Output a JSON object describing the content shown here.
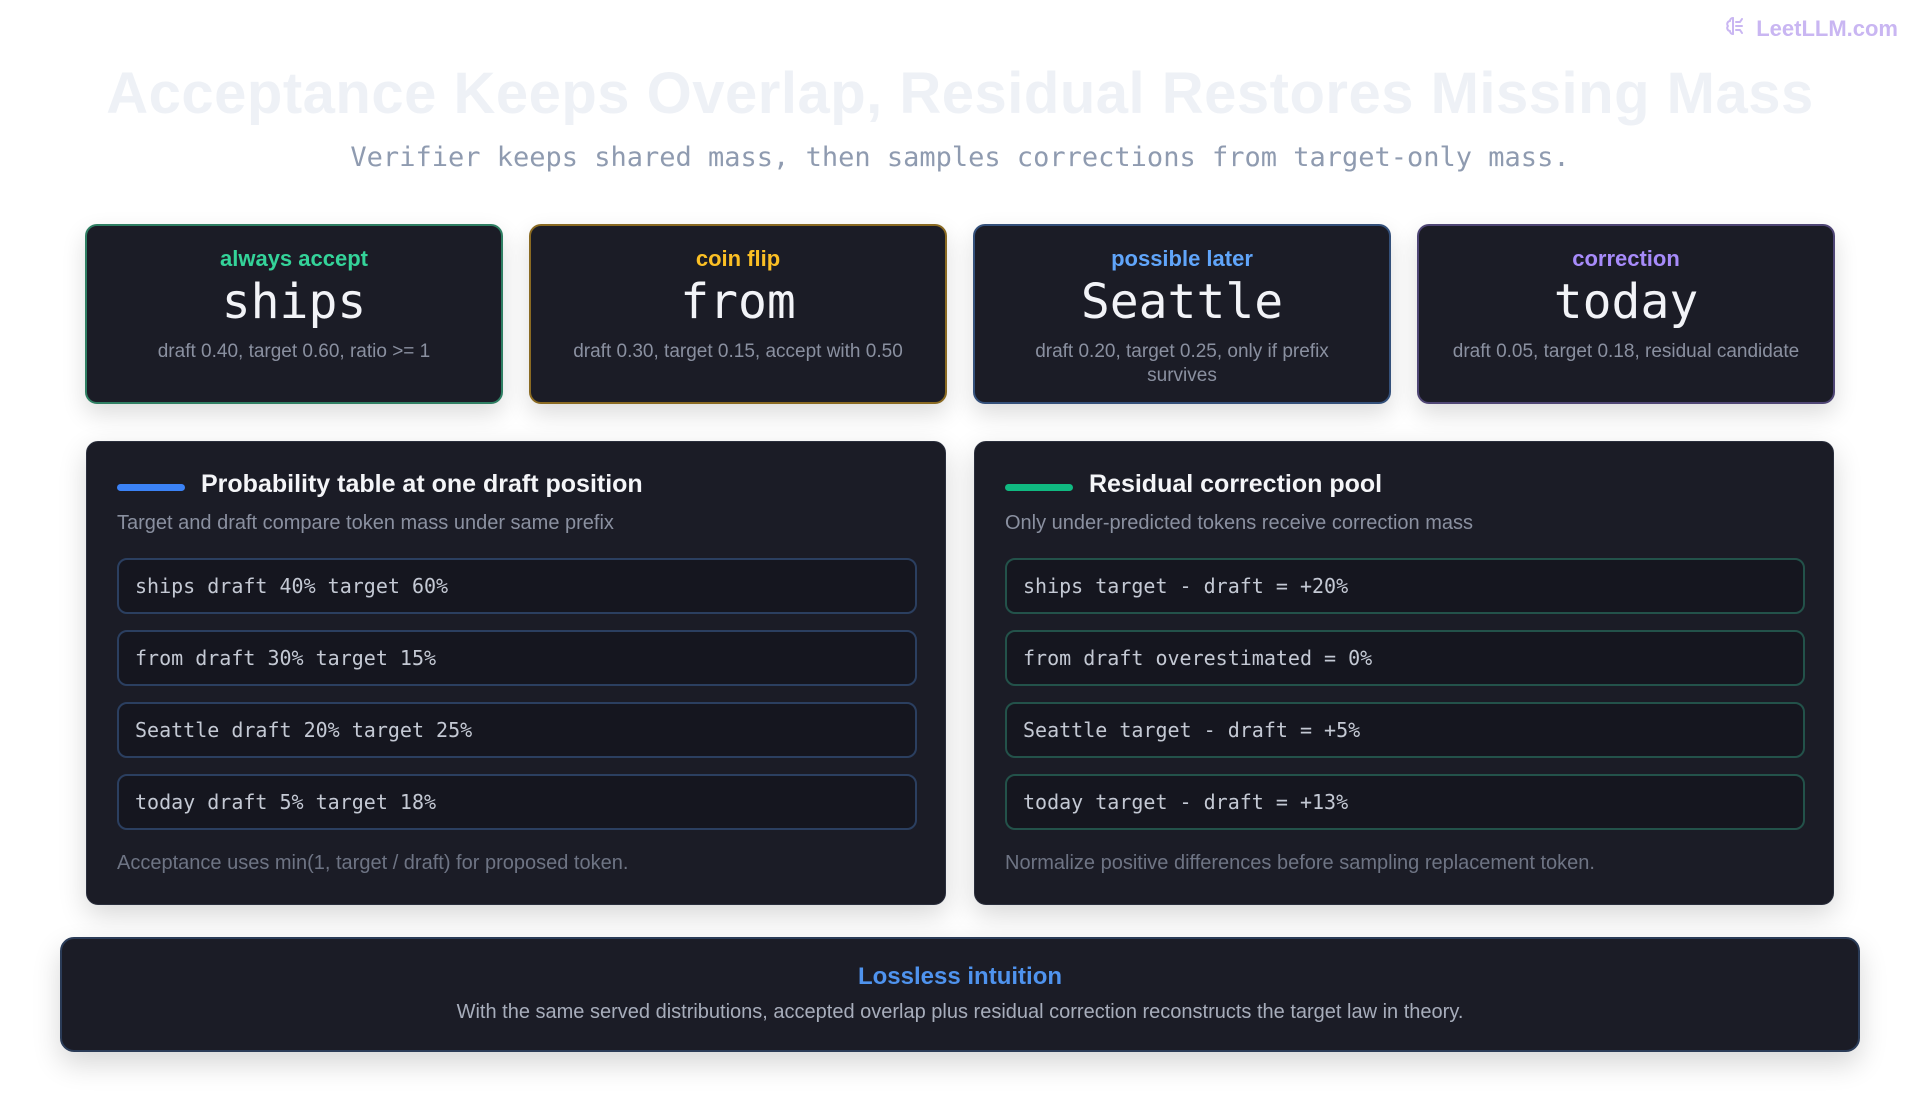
{
  "brand": {
    "name": "LeetLLM.com",
    "icon": "brain-icon",
    "color": "#c9b6f2"
  },
  "header": {
    "title": "Acceptance Keeps Overlap, Residual Restores Missing Mass",
    "subtitle": "Verifier keeps shared mass, then samples corrections from target-only mass."
  },
  "cards": [
    {
      "kicker": "always accept",
      "word": "ships",
      "desc": "draft 0.40, target 0.60, ratio >= 1",
      "accent": "#34d399",
      "border": "#2f7f63"
    },
    {
      "kicker": "coin flip",
      "word": "from",
      "desc": "draft 0.30, target 0.15, accept with 0.50",
      "accent": "#fbbf24",
      "border": "#8a6a22"
    },
    {
      "kicker": "possible later",
      "word": "Seattle",
      "desc": "draft 0.20, target 0.25, only if prefix survives",
      "accent": "#60a5fa",
      "border": "#34507a"
    },
    {
      "kicker": "correction",
      "word": "today",
      "desc": "draft 0.05, target 0.18, residual candidate",
      "accent": "#a78bfa",
      "border": "#4f4675"
    }
  ],
  "panels": {
    "left": {
      "title": "Probability table at one draft position",
      "subtitle": "Target and draft compare token mass under same prefix",
      "bar_color": "#3b82f6",
      "row_border": "#2b3f60",
      "rows": [
        "ships draft 40% target 60%",
        "from draft 30% target 15%",
        "Seattle draft 20% target 25%",
        "today draft 5% target 18%"
      ],
      "note": "Acceptance uses min(1, target / draft) for proposed token."
    },
    "right": {
      "title": "Residual correction pool",
      "subtitle": "Only under-predicted tokens receive correction mass",
      "bar_color": "#10b981",
      "row_border": "#23524a",
      "rows": [
        "ships target - draft = +20%",
        "from draft overestimated = 0%",
        "Seattle target - draft = +5%",
        "today target - draft = +13%"
      ],
      "note": "Normalize positive differences before sampling replacement token."
    }
  },
  "footer": {
    "title": "Lossless intuition",
    "text": "With the same served distributions, accepted overlap plus residual correction reconstructs the target law in theory."
  }
}
